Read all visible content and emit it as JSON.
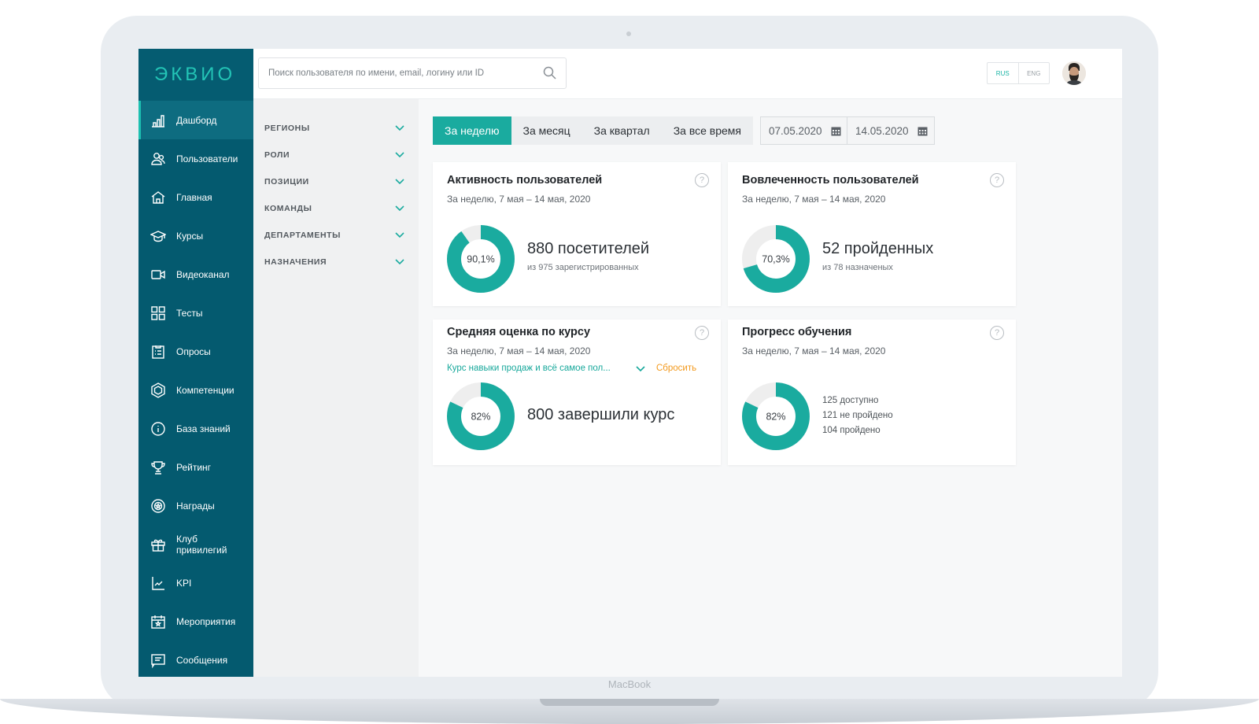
{
  "device": {
    "label": "MacBook"
  },
  "logo": "ЭКВИО",
  "search": {
    "placeholder": "Поиск пользователя по имени, email, логину или ID"
  },
  "lang": {
    "rus": "RUS",
    "eng": "ENG"
  },
  "sidebar": {
    "items": [
      {
        "label": "Дашборд",
        "icon": "dashboard-icon"
      },
      {
        "label": "Пользователи",
        "icon": "users-icon"
      },
      {
        "label": "Главная",
        "icon": "home-icon"
      },
      {
        "label": "Курсы",
        "icon": "graduation-cap-icon"
      },
      {
        "label": "Видеоканал",
        "icon": "video-icon"
      },
      {
        "label": "Тесты",
        "icon": "grid-icon"
      },
      {
        "label": "Опросы",
        "icon": "checklist-icon"
      },
      {
        "label": "Компетенции",
        "icon": "hexagon-icon"
      },
      {
        "label": "База знаний",
        "icon": "info-icon"
      },
      {
        "label": "Рейтинг",
        "icon": "trophy-icon"
      },
      {
        "label": "Награды",
        "icon": "medal-icon"
      },
      {
        "label": "Клуб привилегий",
        "icon": "gift-icon"
      },
      {
        "label": "KPI",
        "icon": "chart-line-icon"
      },
      {
        "label": "Мероприятия",
        "icon": "calendar-star-icon"
      },
      {
        "label": "Сообщения",
        "icon": "message-icon"
      }
    ]
  },
  "filters": [
    "РЕГИОНЫ",
    "РОЛИ",
    "ПОЗИЦИИ",
    "КОМАНДЫ",
    "ДЕПАРТАМЕНТЫ",
    "НАЗНАЧЕНИЯ"
  ],
  "period": {
    "tabs": [
      "За неделю",
      "За месяц",
      "За квартал",
      "За все время"
    ],
    "active": 0,
    "date_from": "07.05.2020",
    "date_to": "14.05.2020"
  },
  "cards": {
    "activity": {
      "title": "Активность пользователей",
      "subtitle": "За неделю, 7 мая – 14 мая, 2020",
      "donut_label": "90,1%",
      "donut_value": 0.901,
      "big": "880 посетителей",
      "small": "из 975 зарегистрированных"
    },
    "engagement": {
      "title": "Вовлеченность пользователей",
      "subtitle": "За неделю, 7 мая – 14 мая, 2020",
      "donut_label": "70,3%",
      "donut_value": 0.703,
      "big": "52 пройденных",
      "small": "из 78 назначеных"
    },
    "rating": {
      "title": "Средняя оценка по курсу",
      "subtitle": "За неделю, 7 мая – 14 мая, 2020",
      "course": "Курс навыки продаж и всё самое пол...",
      "reset": "Сбросить",
      "donut_label": "82%",
      "donut_value": 0.82,
      "big": "800 завершили курс"
    },
    "progress": {
      "title": "Прогресс обучения",
      "subtitle": "За неделю, 7 мая – 14 мая, 2020",
      "donut_label": "82%",
      "donut_value": 0.82,
      "lines": [
        "125 доступно",
        "121 не пройдено",
        "104 пройдено"
      ]
    }
  },
  "colors": {
    "sidebar": "#045a6f",
    "accent": "#1aab9f",
    "reset": "#f39a1e"
  }
}
